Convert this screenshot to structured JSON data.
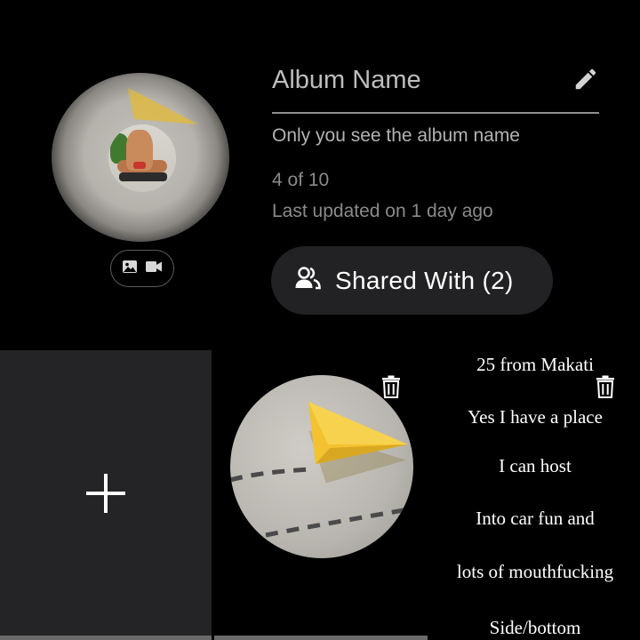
{
  "album": {
    "name_placeholder": "Album Name",
    "visibility_hint": "Only you see the album name",
    "count": "4 of 10",
    "last_updated_label": "Last updated on",
    "last_updated_value": "1 day ago",
    "shared_with_label": "Shared With (2)"
  },
  "icons": {
    "edit": "pencil-icon",
    "media": [
      "image-icon",
      "video-icon"
    ],
    "shared": "people-icon",
    "add": "plus-icon",
    "delete": "trash-icon"
  },
  "grid": {
    "message_lines": [
      "25 from Makati",
      "Yes I have a place",
      "I can host",
      "Into car fun and",
      "lots of mouthfucking",
      "Side/bottom"
    ]
  },
  "colors": {
    "background": "#000000",
    "button_bg": "#222224",
    "tile_bg": "#242426",
    "plane_yellow": "#f2c230"
  }
}
